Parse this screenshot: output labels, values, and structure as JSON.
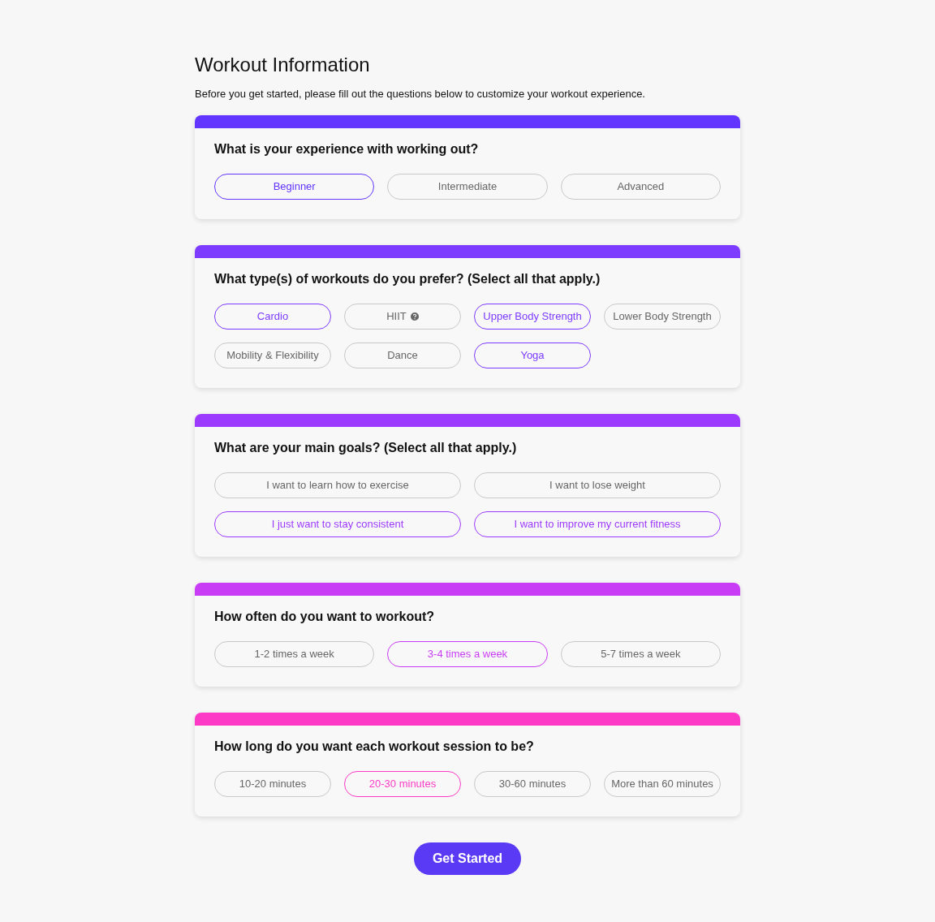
{
  "title": "Workout Information",
  "intro": "Before you get started, please fill out the questions below to customize your workout experience.",
  "sections": [
    {
      "question": "What is your experience with working out?",
      "color": "#6236ff",
      "kind": "row",
      "options": [
        {
          "label": "Beginner",
          "selected": true
        },
        {
          "label": "Intermediate",
          "selected": false
        },
        {
          "label": "Advanced",
          "selected": false
        }
      ]
    },
    {
      "question": "What type(s) of workouts do you prefer? (Select all that apply.)",
      "color": "#7d3bff",
      "kind": "grid",
      "options": [
        {
          "label": "Cardio",
          "selected": true
        },
        {
          "label": "HIIT",
          "selected": false,
          "help": true
        },
        {
          "label": "Upper Body Strength",
          "selected": true
        },
        {
          "label": "Lower Body Strength",
          "selected": false
        },
        {
          "label": "Mobility & Flexibility",
          "selected": false
        },
        {
          "label": "Dance",
          "selected": false
        },
        {
          "label": "Yoga",
          "selected": true
        }
      ]
    },
    {
      "question": "What are your main goals? (Select all that apply.)",
      "color": "#9d3aff",
      "kind": "pairs",
      "options": [
        {
          "label": "I want to learn how to exercise",
          "selected": false
        },
        {
          "label": "I want to lose weight",
          "selected": false
        },
        {
          "label": "I just want to stay consistent",
          "selected": true
        },
        {
          "label": "I want to improve my current fitness",
          "selected": true
        }
      ]
    },
    {
      "question": "How often do you want to workout?",
      "color": "#c93cf5",
      "kind": "row",
      "options": [
        {
          "label": "1-2 times a week",
          "selected": false
        },
        {
          "label": "3-4 times a week",
          "selected": true
        },
        {
          "label": "5-7 times a week",
          "selected": false
        }
      ]
    },
    {
      "question": "How long do you want each workout session to be?",
      "color": "#fc3ac6",
      "kind": "row",
      "options": [
        {
          "label": "10-20 minutes",
          "selected": false
        },
        {
          "label": "20-30 minutes",
          "selected": true
        },
        {
          "label": "30-60 minutes",
          "selected": false
        },
        {
          "label": "More than 60 minutes",
          "selected": false
        }
      ]
    }
  ],
  "submit": "Get Started"
}
